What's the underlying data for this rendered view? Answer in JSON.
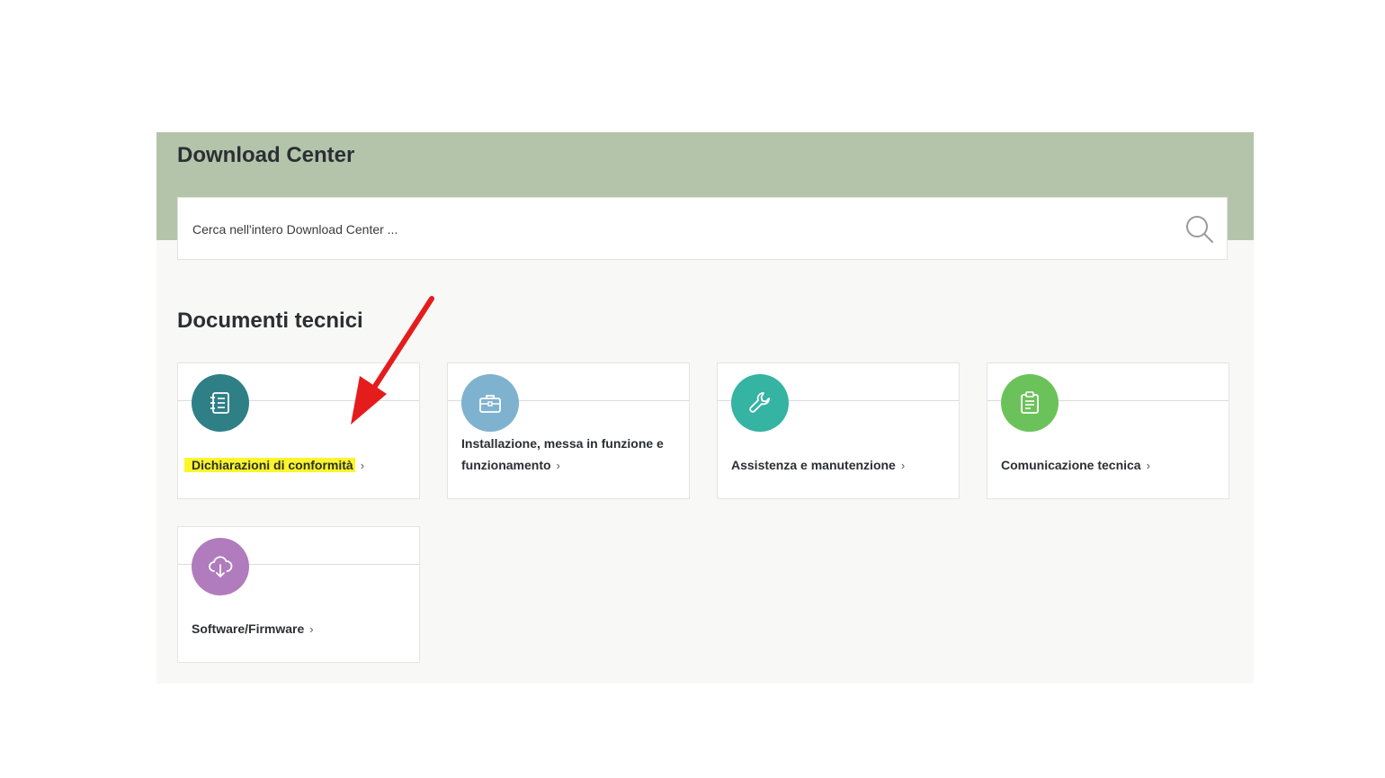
{
  "header": {
    "title": "Download Center"
  },
  "search": {
    "placeholder": "Cerca nell'intero Download Center ..."
  },
  "section": {
    "title": "Documenti tecnici"
  },
  "cards": [
    {
      "label": "Dichiarazioni di conformità",
      "icon": "notebook-icon",
      "color": "#2f7f86",
      "highlighted": true
    },
    {
      "label": "Installazione, messa in funzione e funzionamento",
      "icon": "toolbox-icon",
      "color": "#7fb2cf"
    },
    {
      "label": "Assistenza e manutenzione",
      "icon": "wrench-icon",
      "color": "#35b3a3"
    },
    {
      "label": "Comunicazione tecnica",
      "icon": "clipboard-icon",
      "color": "#6cc25a"
    },
    {
      "label": "Software/Firmware",
      "icon": "cloud-download-icon",
      "color": "#b07cbd"
    }
  ],
  "annotation": {
    "icon": "red-arrow-icon",
    "color": "#e41c1c",
    "highlight_color": "#fbf52a"
  },
  "chevron": "›"
}
